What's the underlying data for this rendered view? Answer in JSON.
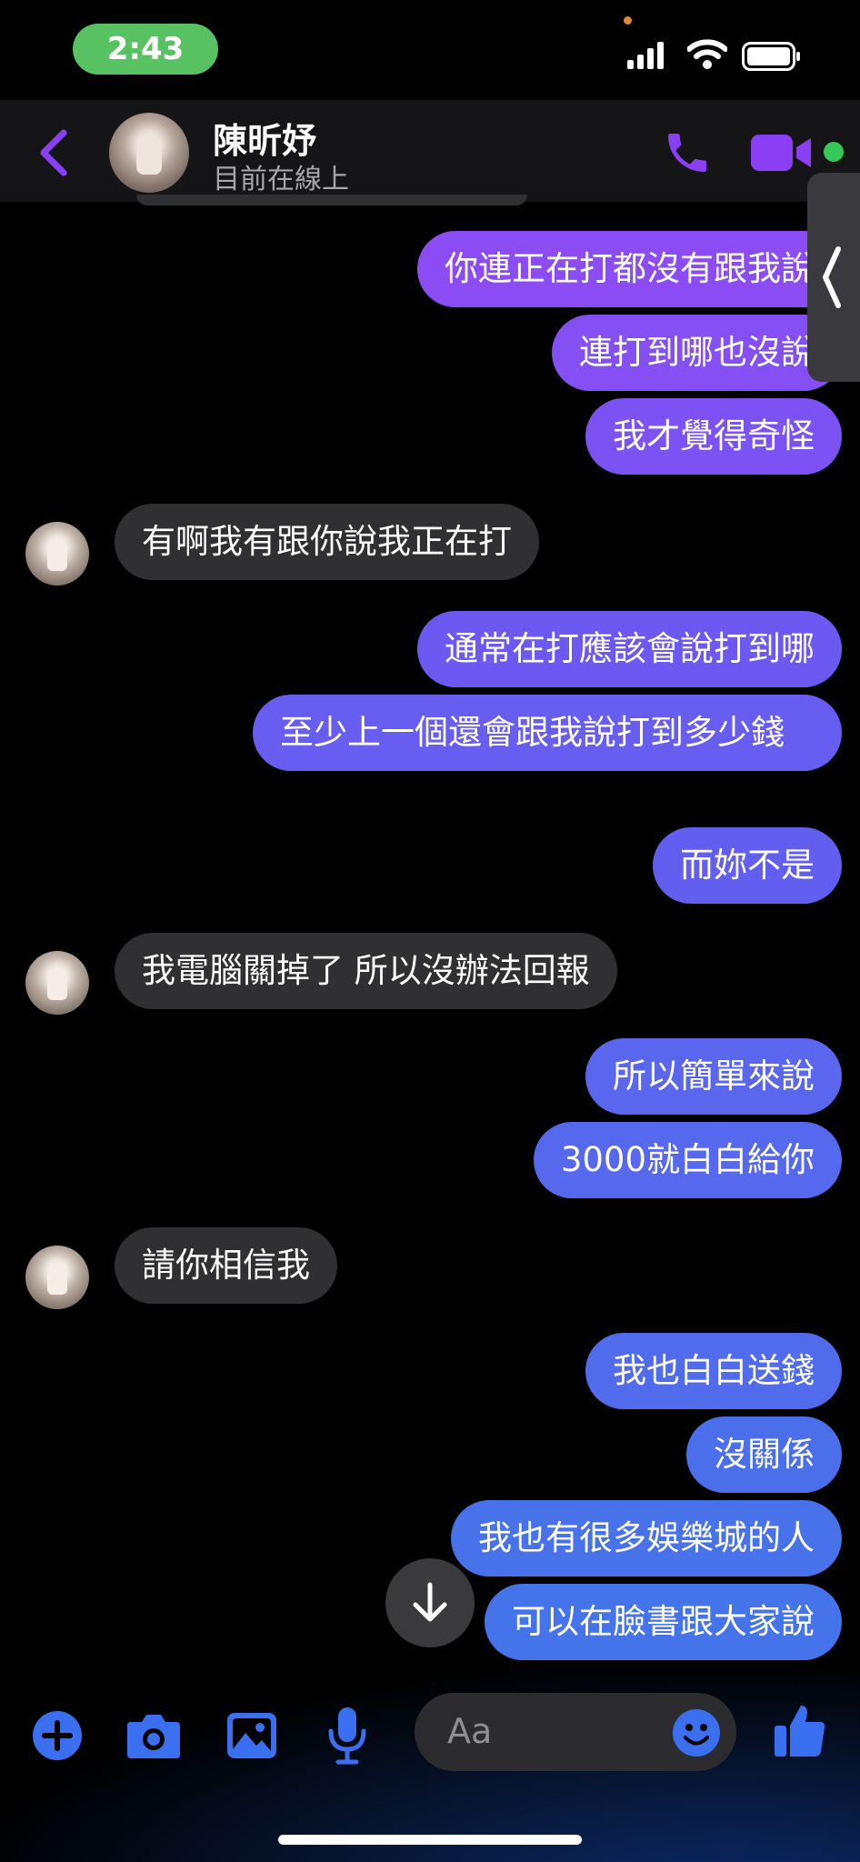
{
  "status_bar": {
    "time": "2:43"
  },
  "header": {
    "contact_name": "陳昕妤",
    "contact_status": "目前在線上"
  },
  "messages": [
    {
      "dir": "out",
      "text": "你連正在打都沒有跟我說"
    },
    {
      "dir": "out",
      "text": "連打到哪也沒說"
    },
    {
      "dir": "out",
      "text": "我才覺得奇怪"
    },
    {
      "dir": "in",
      "text": "有啊我有跟你說我正在打"
    },
    {
      "dir": "out",
      "text": "通常在打應該會說打到哪"
    },
    {
      "dir": "out",
      "text": "至少上一個還會跟我說打到多少錢"
    },
    {
      "dir": "out",
      "text": "而妳不是"
    },
    {
      "dir": "in",
      "text": "我電腦關掉了 所以沒辦法回報"
    },
    {
      "dir": "out",
      "text": "所以簡單來說"
    },
    {
      "dir": "out",
      "text": "3000就白白給你"
    },
    {
      "dir": "in",
      "text": "請你相信我"
    },
    {
      "dir": "out",
      "text": "我也白白送錢"
    },
    {
      "dir": "out",
      "text": "沒關係"
    },
    {
      "dir": "out",
      "text": "我也有很多娛樂城的人"
    },
    {
      "dir": "out",
      "text": "可以在臉書跟大家說"
    }
  ],
  "composer": {
    "placeholder": "Aa"
  },
  "colors": {
    "accent_purple": "#8a3ff5",
    "online_green": "#34c759",
    "status_pill": "#58c262",
    "composer_blue": "#3a6ff0"
  },
  "icons": [
    "signal-icon",
    "wifi-icon",
    "battery-icon",
    "back-icon",
    "phone-icon",
    "video-icon",
    "plus-icon",
    "camera-icon",
    "image-icon",
    "microphone-icon",
    "emoji-icon",
    "like-icon",
    "arrow-down-icon"
  ]
}
